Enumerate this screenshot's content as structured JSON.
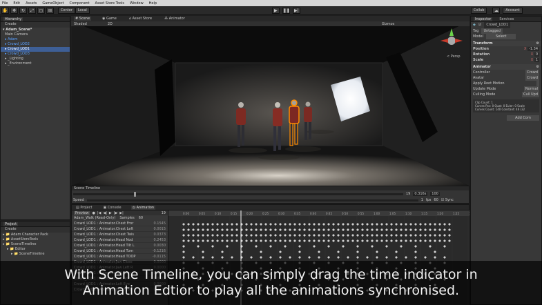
{
  "menu": [
    "File",
    "Edit",
    "Assets",
    "GameObject",
    "Component",
    "Asset Store Tools",
    "Window",
    "Help"
  ],
  "toolbar": {
    "center": "Center",
    "local": "Local",
    "collab": "Collab",
    "account": "Account"
  },
  "hierarchy": {
    "tab": "Hierarchy",
    "create": "Create",
    "scene": "Adam_Scene*",
    "items": [
      {
        "label": "Main Camera",
        "style": "normal"
      },
      {
        "label": "Adam",
        "style": "blue"
      },
      {
        "label": "Crowd_LOD2",
        "style": "blue"
      },
      {
        "label": "Crowd_LOD1",
        "style": "selected"
      },
      {
        "label": "Crowd_LOD3",
        "style": "blue"
      },
      {
        "label": "_Lighting",
        "style": "normal"
      },
      {
        "label": "_Environment",
        "style": "normal"
      }
    ]
  },
  "sceneTabs": {
    "scene": "Scene",
    "game": "Game",
    "assetstore": "Asset Store",
    "animator": "Animator",
    "shaded": "Shaded",
    "mode2d": "2D",
    "gizmos": "Gizmos",
    "persp": "< Persp"
  },
  "project": {
    "tab": "Project",
    "create": "Create",
    "items": [
      {
        "label": "Adam Character Pack",
        "indent": 0
      },
      {
        "label": "AssetStoreTools",
        "indent": 0
      },
      {
        "label": "SceneTimeline",
        "indent": 0
      },
      {
        "label": "Editor",
        "indent": 1
      },
      {
        "label": "SceneTimeline",
        "indent": 2
      }
    ]
  },
  "sceneTimeline": {
    "title": "Scene Timeline",
    "frame": "19",
    "time": "0.316s",
    "max": "100",
    "speedLabel": "Speed",
    "speedValue": "1",
    "fps": "fps",
    "fpsValue": "60",
    "sync": "Sync"
  },
  "bottomTabs": {
    "project": "Project",
    "console": "Console",
    "animation": "Animation",
    "preview": "Preview",
    "clip": "Adam_Walk (Read-Only)",
    "samples": "Samples",
    "samplesValue": "60",
    "frame": "19"
  },
  "rulerLabels": [
    "0:00",
    "0:05",
    "0:10",
    "0:15",
    "0:20",
    "0:25",
    "0:30",
    "0:35",
    "0:40",
    "0:45",
    "0:50",
    "0:55",
    "1:00",
    "1:05",
    "1:10",
    "1:15",
    "1:20",
    "1:25",
    "1:30"
  ],
  "properties": [
    {
      "label": "Crowd_LOD1 : Animator.Chest Fror",
      "value": "0.1545"
    },
    {
      "label": "Crowd_LOD1 : Animator.Chest Left",
      "value": "0.0015"
    },
    {
      "label": "Crowd_LOD1 : Animator.Chest Twis",
      "value": "0.0373"
    },
    {
      "label": "Crowd_LOD1 : Animator.Head Nod",
      "value": "0.2453"
    },
    {
      "label": "Crowd_LOD1 : Animator.Head Tilt L",
      "value": "0.0030"
    },
    {
      "label": "Crowd_LOD1 : Animator.Head Turn",
      "value": "-0.1216"
    },
    {
      "label": "Crowd_LOD1 : Animator.Head TOOP",
      "value": "-0.0115"
    },
    {
      "label": "Crowd_LOD1 : Animator.Jaw Close",
      "value": "0.0000"
    },
    {
      "label": "Crowd_LOD1 : Animator.Jaw Left R",
      "value": "0.0000"
    },
    {
      "label": "Crowd_LOD1 : Animator.Left Arm",
      "value": "0.1234"
    },
    {
      "label": "Crowd_LOD1 : Animator.Left Arm",
      "value": "0.0521"
    },
    {
      "label": "Crowd_LOD1 : Animator.Left Eye",
      "value": "0.0000"
    },
    {
      "label": "Crowd_LOD1 : Animator.Left Foot",
      "value": "0.3812"
    }
  ],
  "inspector": {
    "tabs": [
      "Inspector",
      "Services"
    ],
    "objectName": "Crowd_LOD1",
    "tagLabel": "Tag",
    "tagValue": "Untagged",
    "modelLabel": "Model",
    "modelSelect": "Select",
    "transform": {
      "title": "Transform",
      "rows": [
        {
          "label": "Position",
          "axis": "X",
          "value": "-1.34"
        },
        {
          "label": "Rotation",
          "axis": "X",
          "value": "0"
        },
        {
          "label": "Scale",
          "axis": "X",
          "value": "1"
        }
      ]
    },
    "animator": {
      "title": "Animator",
      "rows": [
        {
          "label": "Controller",
          "value": "Crowd"
        },
        {
          "label": "Avatar",
          "value": "Crowd"
        },
        {
          "label": "Apply Root Motion",
          "value": ""
        },
        {
          "label": "Update Mode",
          "value": "Normal"
        },
        {
          "label": "Culling Mode",
          "value": "Cull Upd"
        }
      ],
      "info": [
        "Clip Count: 1",
        "Curves Pos: 0 Quat: 0 Euler: 0 Scale",
        "Curves Count: 140 Constant: 46 (32"
      ]
    },
    "addComponent": "Add Com"
  },
  "caption": {
    "line1": "With Scene Timeline, you can simply drag the time indicator in",
    "line2": "Animation Edtior to play all the animations synchronised."
  }
}
